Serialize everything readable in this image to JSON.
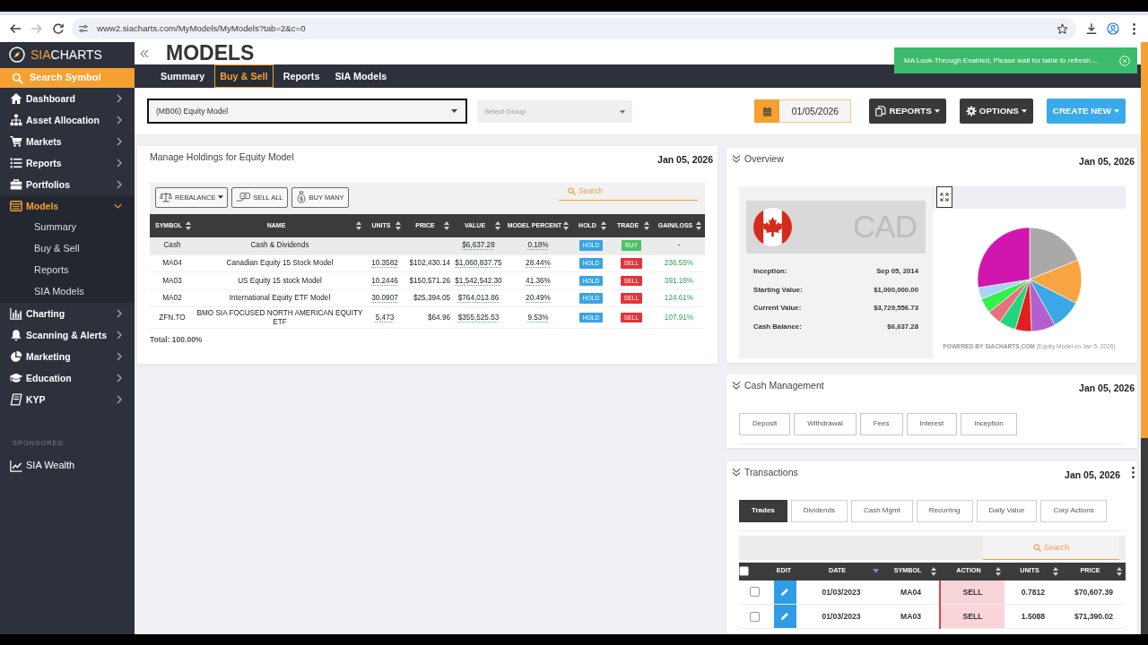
{
  "browser": {
    "url": "www2.siacharts.com/MyModels/MyModels?tab=2&c=0",
    "forward_disabled": true
  },
  "sidebar": {
    "logo": [
      "SIA",
      "CHARTS"
    ],
    "search": "Search Symbol",
    "items": [
      {
        "label": "Dashboard",
        "selected": false,
        "expanded": false
      },
      {
        "label": "Asset Allocation",
        "selected": false,
        "expanded": false
      },
      {
        "label": "Markets",
        "selected": false,
        "expanded": false
      },
      {
        "label": "Reports",
        "selected": false,
        "expanded": false
      },
      {
        "label": "Portfolios",
        "selected": false,
        "expanded": false
      },
      {
        "label": "Models",
        "selected": true,
        "expanded": true,
        "children": [
          {
            "label": "Summary",
            "selected": false
          },
          {
            "label": "Buy & Sell",
            "selected": false
          },
          {
            "label": "Reports",
            "selected": false
          },
          {
            "label": "SIA Models",
            "selected": false
          }
        ]
      },
      {
        "label": "Charting",
        "selected": false,
        "expanded": false
      },
      {
        "label": "Scanning & Alerts",
        "selected": false,
        "expanded": false
      },
      {
        "label": "Marketing",
        "selected": false,
        "expanded": false
      },
      {
        "label": "Education",
        "selected": false,
        "expanded": false
      },
      {
        "label": "KYP",
        "selected": false,
        "expanded": false
      }
    ],
    "sponsored": {
      "label": "SPONSORED",
      "items": [
        {
          "label": "SIA Wealth"
        }
      ]
    }
  },
  "header": {
    "title": "MODELS",
    "tabs": [
      {
        "label": "Summary",
        "selected": false
      },
      {
        "label": "Buy & Sell",
        "selected": true
      },
      {
        "label": "Reports",
        "selected": false
      },
      {
        "label": "SIA Models",
        "selected": false
      }
    ]
  },
  "toast": {
    "message": "MA Look-Through Enabled, Please wait for table to refresh...."
  },
  "toolbar": {
    "model_select": {
      "value": "(MB06) Equity Model"
    },
    "group_select": {
      "placeholder": "Select Group"
    },
    "date": "01/05/2026",
    "buttons": [
      {
        "label": "REPORTS",
        "kind": "dark",
        "dropdown": true
      },
      {
        "label": "OPTIONS",
        "kind": "dark",
        "dropdown": true
      },
      {
        "label": "CREATE NEW",
        "kind": "primary",
        "dropdown": true
      }
    ]
  },
  "holdings": {
    "title": "Manage Holdings for Equity Model",
    "date": "Jan 05, 2026",
    "actions": [
      {
        "label": "REBALANCE",
        "dropdown": true
      },
      {
        "label": "SELL ALL",
        "dropdown": false
      },
      {
        "label": "BUY MANY",
        "dropdown": false
      }
    ],
    "search": {
      "placeholder": "Search"
    },
    "columns": [
      {
        "label": "SYMBOL"
      },
      {
        "label": "NAME"
      },
      {
        "label": "UNITS"
      },
      {
        "label": "PRICE"
      },
      {
        "label": "VALUE"
      },
      {
        "label": "MODEL PERCENT"
      },
      {
        "label": "HOLD"
      },
      {
        "label": "TRADE"
      },
      {
        "label": "GAIN/LOSS"
      }
    ],
    "rows": [
      {
        "kind": "cash",
        "symbol": "Cash",
        "name": "Cash & Dividends",
        "value": "$6,637.28",
        "model_percent": "0.18%",
        "hold": "HOLD",
        "trade": {
          "label": "BUY",
          "kind": "buy"
        },
        "gain_loss": "-"
      },
      {
        "kind": "holding",
        "symbol": "MA04",
        "name": "Canadian Equity 15 Stock Model",
        "units": "10.3582",
        "price": "$102,430.14",
        "value": "$1,060,837.75",
        "model_percent": "28.44%",
        "hold": "HOLD",
        "trade": {
          "label": "SELL",
          "kind": "sell"
        },
        "gain_loss": "236.55%"
      },
      {
        "kind": "holding",
        "symbol": "MA03",
        "name": "US Equity 15 stock Model",
        "units": "10.2446",
        "price": "$150,571.26",
        "value": "$1,542,542.30",
        "model_percent": "41.36%",
        "hold": "HOLD",
        "trade": {
          "label": "SELL",
          "kind": "sell"
        },
        "gain_loss": "391.18%"
      },
      {
        "kind": "holding",
        "symbol": "MA02",
        "name": "International Equity ETF Model",
        "units": "30.0907",
        "price": "$25,394.05",
        "value": "$764,013.86",
        "model_percent": "20.49%",
        "hold": "HOLD",
        "trade": {
          "label": "SELL",
          "kind": "sell"
        },
        "gain_loss": "124.61%"
      },
      {
        "kind": "holding",
        "symbol": "ZFN.TO",
        "name": "BMO SIA FOCUSED NORTH AMERICAN EQUITY ETF",
        "units": "5,473",
        "price": "$64.96",
        "value": "$355,525.53",
        "model_percent": "9.53%",
        "hold": "HOLD",
        "trade": {
          "label": "SELL",
          "kind": "sell"
        },
        "gain_loss": "107.91%"
      }
    ],
    "total": "Total: 100.00%"
  },
  "overview": {
    "title": "Overview",
    "date": "Jan 05, 2026",
    "currency": "CAD",
    "stats": [
      {
        "label": "Inception:",
        "value": "Sep 05, 2014"
      },
      {
        "label": "Starting Value:",
        "value": "$1,000,000.00"
      },
      {
        "label": "Current Value:",
        "value": "$3,729,556.73"
      },
      {
        "label": "Cash Balance:",
        "value": "$6,637.28"
      }
    ],
    "caption": "**POWERED BY SIACHARTS.COM** (Equity Model on Jan 5, 2026)"
  },
  "cash_management": {
    "title": "Cash Management",
    "date": "Jan 05, 2026",
    "buttons": [
      "Deposit",
      "Withdrawal",
      "Fees",
      "Interest",
      "Inception"
    ]
  },
  "transactions": {
    "title": "Transactions",
    "date": "Jan 05, 2026",
    "tabs": [
      {
        "label": "Trades",
        "selected": true
      },
      {
        "label": "Dividends",
        "selected": false
      },
      {
        "label": "Cash Mgmt",
        "selected": false
      },
      {
        "label": "Recurring",
        "selected": false
      },
      {
        "label": "Daily Value",
        "selected": false
      },
      {
        "label": "Corp Actions",
        "selected": false
      }
    ],
    "search": {
      "placeholder": "Search"
    },
    "select_all_checked": false,
    "columns": [
      {
        "label": "EDIT",
        "kind": "plain"
      },
      {
        "label": "DATE",
        "kind": "sorted"
      },
      {
        "label": "SYMBOL",
        "kind": "sortable"
      },
      {
        "label": "ACTION",
        "kind": "sortable"
      },
      {
        "label": "UNITS",
        "kind": "sortable"
      },
      {
        "label": "PRICE",
        "kind": "sortable"
      }
    ],
    "rows": [
      {
        "checked": false,
        "date": "01/03/2023",
        "symbol": "MA04",
        "action": {
          "label": "SELL",
          "kind": "sell"
        },
        "units": "0.7812",
        "price": "$70,607.39"
      },
      {
        "checked": false,
        "date": "01/03/2023",
        "symbol": "MA03",
        "action": {
          "label": "SELL",
          "kind": "sell"
        },
        "units": "1.5088",
        "price": "$71,390.02"
      }
    ]
  }
}
